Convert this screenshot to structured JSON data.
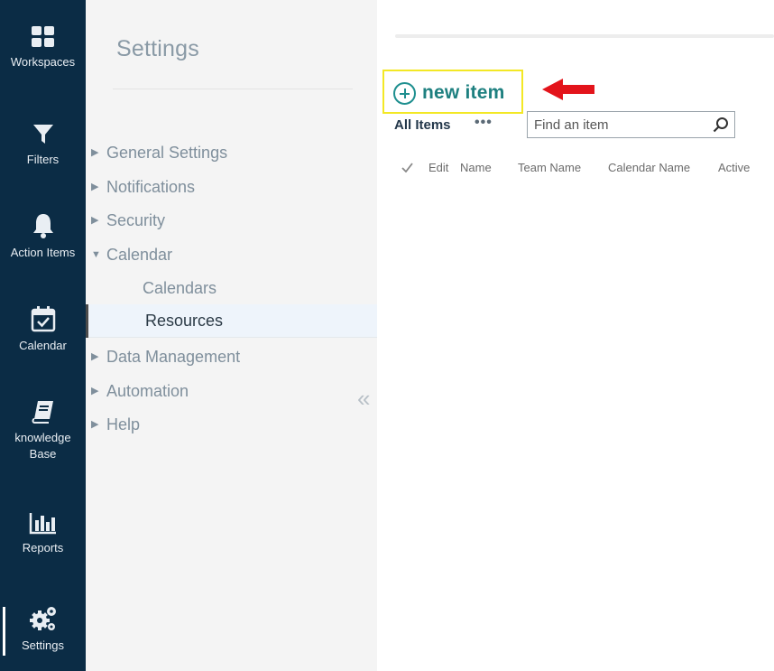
{
  "rail": {
    "items": [
      {
        "label": "Workspaces",
        "icon": "grid-icon"
      },
      {
        "label": "Filters",
        "icon": "funnel-icon"
      },
      {
        "label": "Action Items",
        "icon": "bell-icon"
      },
      {
        "label": "Calendar",
        "icon": "calendar-check-icon"
      },
      {
        "label_line1": "knowledge",
        "label_line2": "Base",
        "icon": "book-icon"
      },
      {
        "label": "Reports",
        "icon": "bar-chart-icon"
      },
      {
        "label": "Settings",
        "icon": "gears-icon"
      }
    ],
    "active": "Settings"
  },
  "nav": {
    "title": "Settings",
    "items": [
      {
        "label": "General Settings",
        "expanded": false
      },
      {
        "label": "Notifications",
        "expanded": false
      },
      {
        "label": "Security",
        "expanded": false
      },
      {
        "label": "Calendar",
        "expanded": true
      },
      {
        "label": "Data Management",
        "expanded": false
      },
      {
        "label": "Automation",
        "expanded": false
      },
      {
        "label": "Help",
        "expanded": false
      }
    ],
    "calendar_children": [
      "Calendars",
      "Resources"
    ],
    "selected": "Resources"
  },
  "main": {
    "new_item_label": "new item",
    "view_label": "All Items",
    "more_label": "•••",
    "search_placeholder": "Find an item",
    "columns": [
      "Edit",
      "Name",
      "Team Name",
      "Calendar Name",
      "Active"
    ]
  },
  "colors": {
    "rail_bg": "#0b2c45",
    "accent_teal": "#1e8080",
    "highlight_yellow": "#f3e825",
    "arrow_red": "#e3141b"
  }
}
